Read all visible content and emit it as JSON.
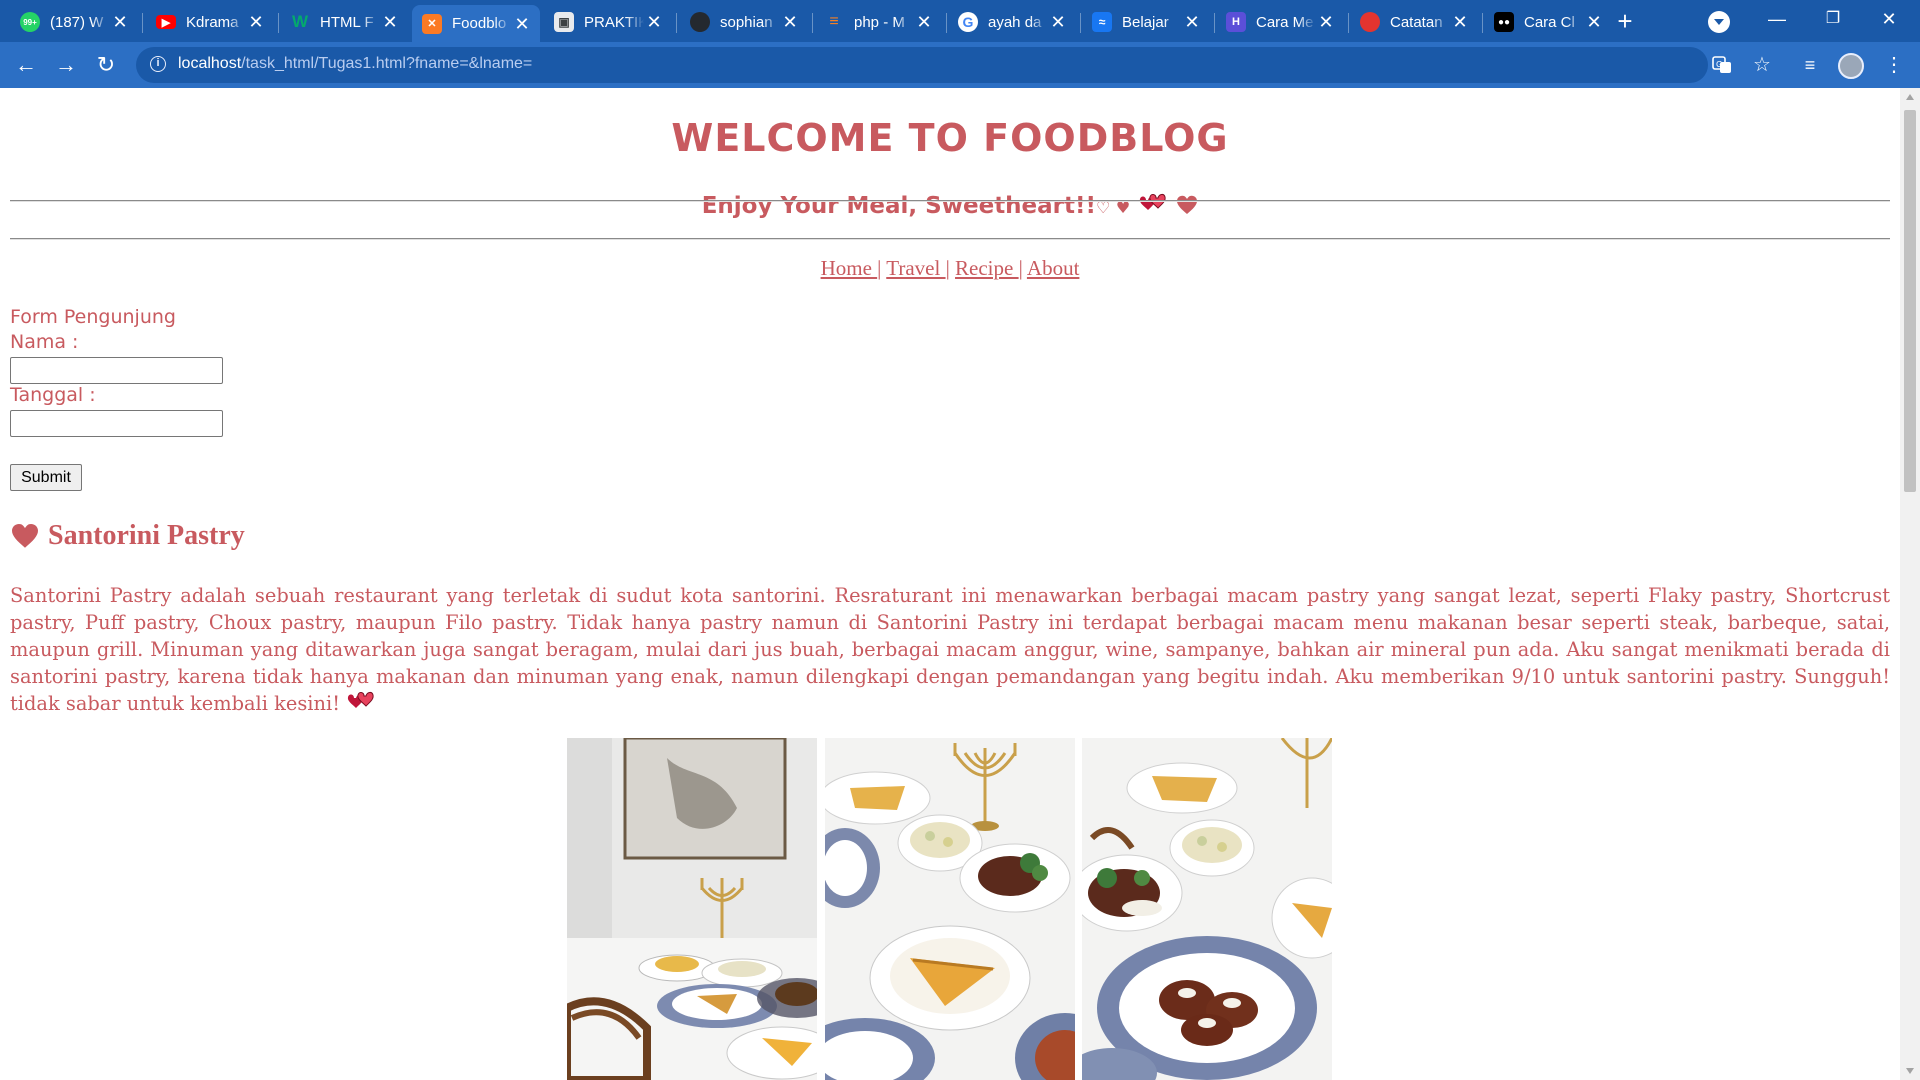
{
  "browser": {
    "tabs": [
      {
        "title": "(187) W",
        "favicon": "whatsapp-icon",
        "color": "#25d366",
        "badge": "99+"
      },
      {
        "title": "Kdrama",
        "favicon": "youtube-icon",
        "color": "#ff0000"
      },
      {
        "title": "HTML F",
        "favicon": "w3schools-icon",
        "color": "#04aa6d"
      },
      {
        "title": "Foodblo",
        "favicon": "xampp-icon",
        "color": "#fb7a24",
        "active": true
      },
      {
        "title": "PRAKTIK",
        "favicon": "classroom-icon",
        "color": "#3c4043"
      },
      {
        "title": "sophian",
        "favicon": "github-icon",
        "color": "#24292f"
      },
      {
        "title": "php - M",
        "favicon": "stackoverflow-icon",
        "color": "#f48024"
      },
      {
        "title": "ayah da",
        "favicon": "google-icon",
        "color": "#ffffff"
      },
      {
        "title": "Belajar",
        "favicon": "belajar-icon",
        "color": "#1877f2"
      },
      {
        "title": "Cara Me",
        "favicon": "site-icon",
        "color": "#5b4fd8"
      },
      {
        "title": "Catatan",
        "favicon": "catatan-icon",
        "color": "#e3342f"
      },
      {
        "title": "Cara Cl",
        "favicon": "medium-icon",
        "color": "#000000"
      }
    ],
    "url_host": "localhost",
    "url_path": "/task_html/Tugas1.html?fname=&lname=",
    "accent": "#1a59a8"
  },
  "page": {
    "title": "WELCOME TO FOODBLOG",
    "subtitle": "Enjoy Your Meal, Sweetheart!!",
    "subtitle_glyphs": "♡ ♥",
    "nav": {
      "home": "Home ",
      "travel": "Travel ",
      "recipe": "Recipe ",
      "about": "About",
      "separator": "|"
    },
    "form": {
      "heading": "Form Pengunjung",
      "nama_label": "Nama :",
      "tanggal_label": "Tanggal :",
      "submit_label": "Submit",
      "nama_value": "",
      "tanggal_value": ""
    },
    "section": {
      "title": "Santorini Pastry",
      "body": "Santorini Pastry adalah sebuah restaurant yang terletak di sudut kota santorini. Resraturant ini menawarkan berbagai macam pastry yang sangat lezat, seperti Flaky pastry, Shortcrust pastry, Puff pastry, Choux pastry, maupun Filo pastry. Tidak hanya pastry namun di Santorini Pastry ini terdapat berbagai macam menu makanan besar seperti steak, barbeque, satai, maupun grill. Minuman yang ditawarkan juga sangat beragam, mulai dari jus buah, berbagai macam anggur, wine, sampanye, bahkan air mineral pun ada. Aku sangat menikmati berada di santorini pastry, karena tidak hanya makanan dan minuman yang enak, namun dilengkapi dengan pemandangan yang begitu indah. Aku memberikan 9/10 untuk santorini pastry. Sungguh! tidak sabar untuk kembali kesini!"
    },
    "text_color": "#c85a5f"
  }
}
